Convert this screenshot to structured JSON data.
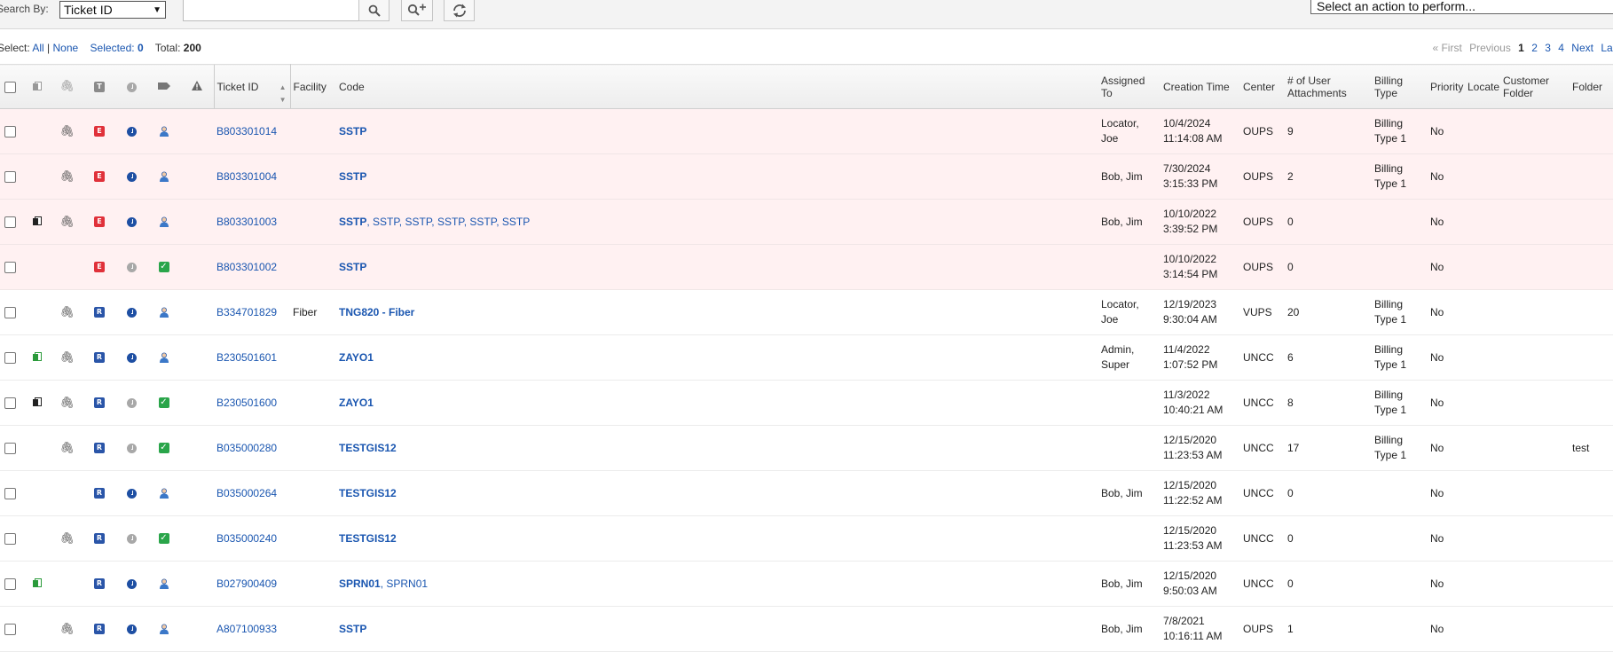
{
  "toolbar": {
    "search_by_label": "Search By:",
    "search_by_value": "Ticket ID",
    "search_value": "",
    "action_placeholder": "Select an action to perform..."
  },
  "selection": {
    "select_label": "Select:",
    "all": "All",
    "sep": "|",
    "none": "None",
    "selected_label": "Selected:",
    "selected_count": "0",
    "total_label": "Total:",
    "total_count": "200"
  },
  "pager": {
    "first": "« First",
    "previous": "Previous",
    "pages": [
      "1",
      "2",
      "3",
      "4"
    ],
    "current": "1",
    "next": "Next",
    "last": "Last"
  },
  "columns": {
    "ticket_id": "Ticket ID",
    "facility": "Facility",
    "code": "Code",
    "assigned_to": "Assigned To",
    "creation_time": "Creation Time",
    "center": "Center",
    "attachments": "# of User Attachments",
    "billing_type": "Billing Type",
    "priority": "Priority",
    "locate": "Locate",
    "customer_folder": "Customer Folder",
    "folder": "Folder"
  },
  "colors": {
    "link": "#1a56b0",
    "row_highlight": "#fff1f2",
    "badge_e": "#e0313a",
    "badge_r": "#2a55a8",
    "ok_green": "#2aa54a"
  },
  "rows": [
    {
      "highlight": true,
      "docs": "",
      "clip": true,
      "type": "E",
      "clock": "blue",
      "status": "person",
      "ticket_id": "B803301014",
      "facility": "",
      "code_main": "SSTP",
      "code_extra": "",
      "assigned": "Locator, Joe",
      "created": "10/4/2024 11:14:08 AM",
      "center": "OUPS",
      "attachments": "9",
      "billing": "Billing Type 1",
      "priority": "No",
      "customer_folder": "",
      "folder": ""
    },
    {
      "highlight": true,
      "docs": "",
      "clip": true,
      "type": "E",
      "clock": "blue",
      "status": "person",
      "ticket_id": "B803301004",
      "facility": "",
      "code_main": "SSTP",
      "code_extra": "",
      "assigned": "Bob, Jim",
      "created": "7/30/2024 3:15:33 PM",
      "center": "OUPS",
      "attachments": "2",
      "billing": "Billing Type 1",
      "priority": "No",
      "customer_folder": "",
      "folder": ""
    },
    {
      "highlight": true,
      "docs": "black",
      "clip": true,
      "type": "E",
      "clock": "blue",
      "status": "person",
      "ticket_id": "B803301003",
      "facility": "",
      "code_main": "SSTP",
      "code_extra": ", SSTP, SSTP, SSTP, SSTP, SSTP",
      "assigned": "Bob, Jim",
      "created": "10/10/2022 3:39:52 PM",
      "center": "OUPS",
      "attachments": "0",
      "billing": "",
      "priority": "No",
      "customer_folder": "",
      "folder": ""
    },
    {
      "highlight": true,
      "docs": "",
      "clip": false,
      "type": "E",
      "clock": "gray",
      "status": "check",
      "ticket_id": "B803301002",
      "facility": "",
      "code_main": "SSTP",
      "code_extra": "",
      "assigned": "",
      "created": "10/10/2022 3:14:54 PM",
      "center": "OUPS",
      "attachments": "0",
      "billing": "",
      "priority": "No",
      "customer_folder": "",
      "folder": ""
    },
    {
      "highlight": false,
      "docs": "",
      "clip": true,
      "type": "R",
      "clock": "blue",
      "status": "person",
      "ticket_id": "B334701829",
      "facility": "Fiber",
      "code_main": "TNG820 - Fiber",
      "code_extra": "",
      "assigned": "Locator, Joe",
      "created": "12/19/2023 9:30:04 AM",
      "center": "VUPS",
      "attachments": "20",
      "billing": "Billing Type 1",
      "priority": "No",
      "customer_folder": "",
      "folder": ""
    },
    {
      "highlight": false,
      "docs": "green",
      "clip": true,
      "type": "R",
      "clock": "blue",
      "status": "person",
      "ticket_id": "B230501601",
      "facility": "",
      "code_main": "ZAYO1",
      "code_extra": "",
      "assigned": "Admin, Super",
      "created": "11/4/2022 1:07:52 PM",
      "center": "UNCC",
      "attachments": "6",
      "billing": "Billing Type 1",
      "priority": "No",
      "customer_folder": "",
      "folder": ""
    },
    {
      "highlight": false,
      "docs": "black",
      "clip": true,
      "type": "R",
      "clock": "gray",
      "status": "check",
      "ticket_id": "B230501600",
      "facility": "",
      "code_main": "ZAYO1",
      "code_extra": "",
      "assigned": "",
      "created": "11/3/2022 10:40:21 AM",
      "center": "UNCC",
      "attachments": "8",
      "billing": "Billing Type 1",
      "priority": "No",
      "customer_folder": "",
      "folder": ""
    },
    {
      "highlight": false,
      "docs": "",
      "clip": true,
      "type": "R",
      "clock": "gray",
      "status": "check",
      "ticket_id": "B035000280",
      "facility": "",
      "code_main": "TESTGIS12",
      "code_extra": "",
      "assigned": "",
      "created": "12/15/2020 11:23:53 AM",
      "center": "UNCC",
      "attachments": "17",
      "billing": "Billing Type 1",
      "priority": "No",
      "customer_folder": "",
      "folder": "test"
    },
    {
      "highlight": false,
      "docs": "",
      "clip": false,
      "type": "R",
      "clock": "blue",
      "status": "person",
      "ticket_id": "B035000264",
      "facility": "",
      "code_main": "TESTGIS12",
      "code_extra": "",
      "assigned": "Bob, Jim",
      "created": "12/15/2020 11:22:52 AM",
      "center": "UNCC",
      "attachments": "0",
      "billing": "",
      "priority": "No",
      "customer_folder": "",
      "folder": ""
    },
    {
      "highlight": false,
      "docs": "",
      "clip": true,
      "type": "R",
      "clock": "gray",
      "status": "check",
      "ticket_id": "B035000240",
      "facility": "",
      "code_main": "TESTGIS12",
      "code_extra": "",
      "assigned": "",
      "created": "12/15/2020 11:23:53 AM",
      "center": "UNCC",
      "attachments": "0",
      "billing": "",
      "priority": "No",
      "customer_folder": "",
      "folder": ""
    },
    {
      "highlight": false,
      "docs": "green",
      "clip": false,
      "type": "R",
      "clock": "blue",
      "status": "person",
      "ticket_id": "B027900409",
      "facility": "",
      "code_main": "SPRN01",
      "code_extra": ", SPRN01",
      "assigned": "Bob, Jim",
      "created": "12/15/2020 9:50:03 AM",
      "center": "UNCC",
      "attachments": "0",
      "billing": "",
      "priority": "No",
      "customer_folder": "",
      "folder": ""
    },
    {
      "highlight": false,
      "docs": "",
      "clip": true,
      "type": "R",
      "clock": "blue",
      "status": "person",
      "ticket_id": "A807100933",
      "facility": "",
      "code_main": "SSTP",
      "code_extra": "",
      "assigned": "Bob, Jim",
      "created": "7/8/2021 10:16:11 AM",
      "center": "OUPS",
      "attachments": "1",
      "billing": "",
      "priority": "No",
      "customer_folder": "",
      "folder": ""
    }
  ]
}
